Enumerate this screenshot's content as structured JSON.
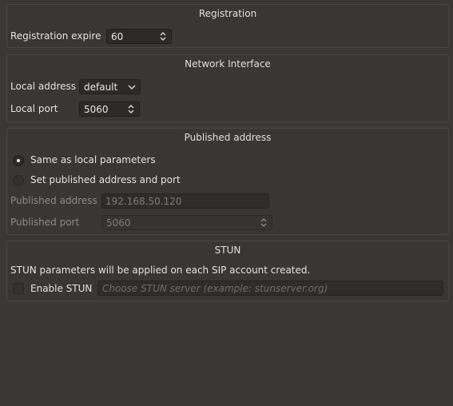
{
  "registration": {
    "title": "Registration",
    "expire_label": "Registration expire",
    "expire_value": "60"
  },
  "network_interface": {
    "title": "Network Interface",
    "local_address_label": "Local address",
    "local_address_value": "default",
    "local_port_label": "Local port",
    "local_port_value": "5060"
  },
  "published_address": {
    "title": "Published address",
    "same_as_local_label": "Same as local parameters",
    "set_published_label": "Set published address and port",
    "published_address_label": "Published address",
    "published_address_value": "192.168.50.120",
    "published_port_label": "Published port",
    "published_port_value": "5060",
    "selected_option": "same_as_local"
  },
  "stun": {
    "title": "STUN",
    "info": "STUN parameters will be applied on each SIP account created.",
    "enable_label": "Enable STUN",
    "enabled": false,
    "server_placeholder": "Choose STUN server (example: stunserver.org)"
  },
  "colors": {
    "background": "#3a3835",
    "field": "#2d2b29",
    "text": "#e8e6e1",
    "disabled_text": "#7f7c77"
  }
}
